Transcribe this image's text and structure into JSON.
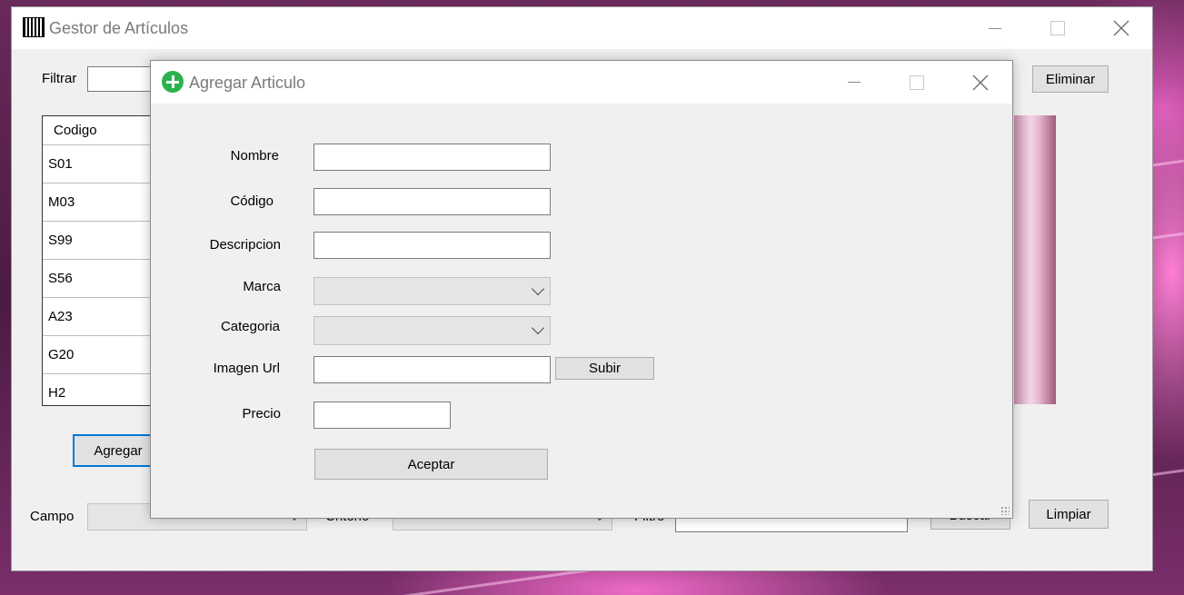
{
  "main_window": {
    "title": "Gestor de Artículos",
    "filter_label": "Filtrar",
    "delete_button": "Eliminar",
    "add_button": "Agregar",
    "grid": {
      "header": "Codigo",
      "rows": [
        "S01",
        "M03",
        "S99",
        "S56",
        "A23",
        "G20",
        "H2"
      ]
    },
    "bottom": {
      "campo_label": "Campo",
      "criterio_label": "Criterio",
      "filtro_label": "Filtro",
      "search_button": "Buscar",
      "clear_button": "Limpiar"
    }
  },
  "dialog": {
    "title": "Agregar Articulo",
    "fields": {
      "nombre_label": "Nombre",
      "codigo_label": "Código",
      "descripcion_label": "Descripcion",
      "marca_label": "Marca",
      "categoria_label": "Categoria",
      "imagen_label": "Imagen Url",
      "precio_label": "Precio"
    },
    "upload_button": "Subir",
    "accept_button": "Aceptar"
  },
  "icons": {
    "main_app": "grid-app-icon",
    "dialog_app": "add-circle-icon"
  },
  "colors": {
    "focus_accent": "#0078d7",
    "add_icon": "#2bb24c"
  }
}
